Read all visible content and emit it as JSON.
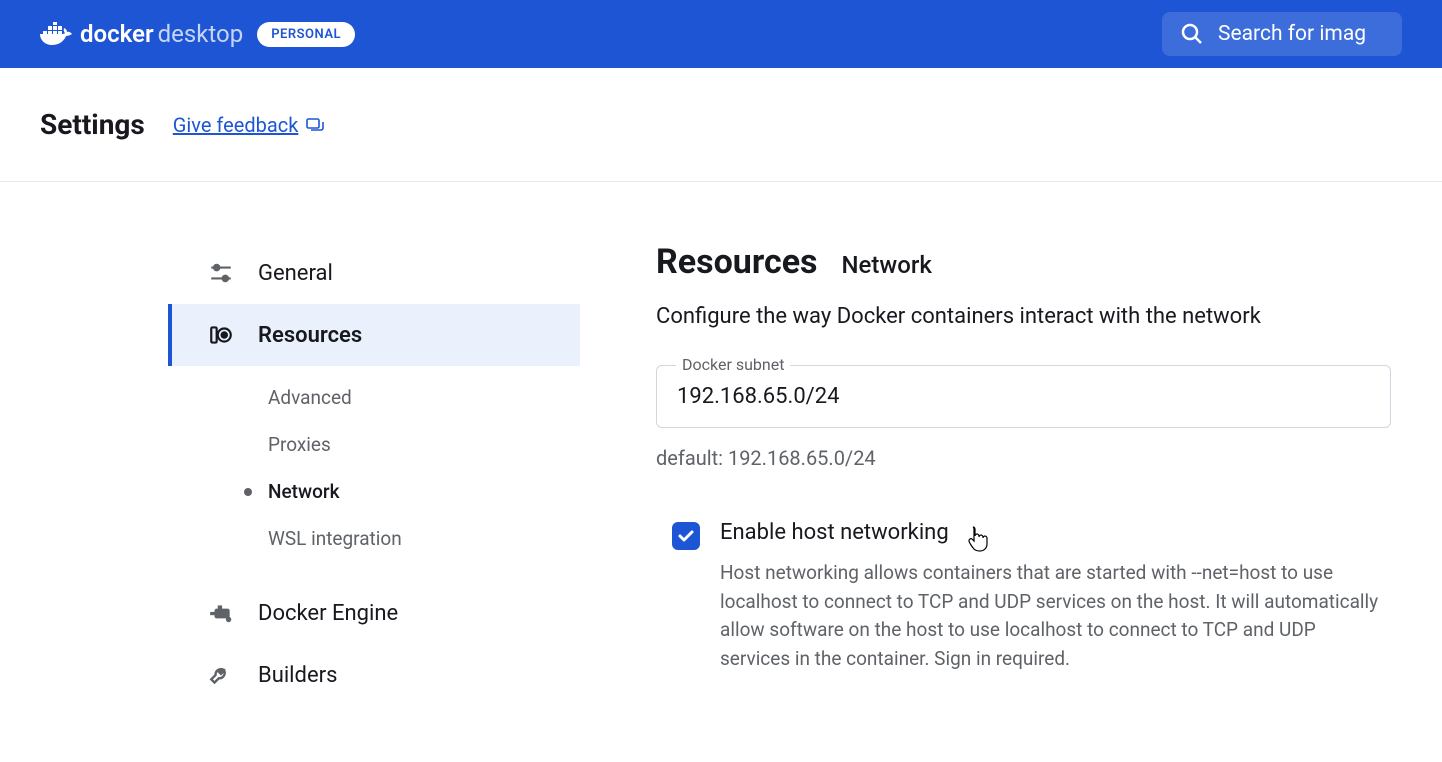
{
  "header": {
    "logo_text": "docker",
    "logo_desktop": "desktop",
    "personal_badge": "PERSONAL",
    "search_placeholder": "Search for imag"
  },
  "page": {
    "title": "Settings",
    "feedback_label": "Give feedback"
  },
  "sidebar": {
    "items": [
      {
        "label": "General",
        "icon": "sliders-icon"
      },
      {
        "label": "Resources",
        "icon": "resources-icon"
      },
      {
        "label": "Docker Engine",
        "icon": "engine-icon"
      },
      {
        "label": "Builders",
        "icon": "wrench-icon"
      }
    ],
    "sub_items": [
      {
        "label": "Advanced"
      },
      {
        "label": "Proxies"
      },
      {
        "label": "Network"
      },
      {
        "label": "WSL integration"
      }
    ]
  },
  "main": {
    "title": "Resources",
    "subtitle": "Network",
    "description": "Configure the way Docker containers interact with the network",
    "subnet_label": "Docker subnet",
    "subnet_value": "192.168.65.0/24",
    "default_hint": "default: 192.168.65.0/24",
    "checkbox_label": "Enable host networking",
    "checkbox_desc": "Host networking allows containers that are started with --net=host to use localhost to connect to TCP and UDP services on the host. It will automatically allow software on the host to use localhost to connect to TCP and UDP services in the container. Sign in required."
  }
}
